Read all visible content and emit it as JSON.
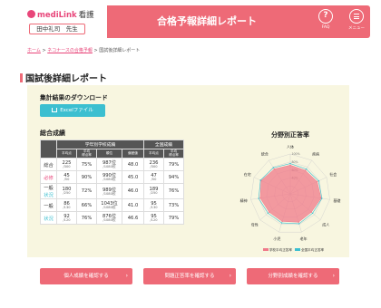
{
  "header": {
    "logo_brand": "mediLink",
    "logo_sub": "看護",
    "user_name": "田中礼司　先生",
    "title": "合格予報詳細レポート",
    "faq_label": "FAQ",
    "faq_icon": "question-circle-icon",
    "menu_label": "メニュー",
    "menu_icon": "hamburger-icon"
  },
  "breadcrumb": {
    "home": "ホーム",
    "sep1": " > ",
    "parent": "ネコナースの合格予報",
    "sep2": " > ",
    "current": "国試後詳細レポート"
  },
  "page_title": "国試後詳細レポート",
  "download": {
    "title": "集計結果のダウンロード",
    "excel_label": "Excelファイル",
    "excel_icon": "download-icon"
  },
  "summary": {
    "title": "総合成績",
    "group_school": "学年別学校成績",
    "group_national": "全国成績",
    "sub_headers": [
      "平均点",
      "平均\n得点率",
      "順位",
      "偏差値",
      "平均点",
      "平均\n得点率"
    ],
    "rows": [
      {
        "label": "総合",
        "label_color": "",
        "avg": "225",
        "avg_of": "/300",
        "rate": "75%",
        "rank": "987位",
        "rank_of": "/1080校",
        "dev": "48.0",
        "nat_avg": "236",
        "nat_of": "/300",
        "nat_rate": "79%"
      },
      {
        "label": "必修",
        "label_color": "pink",
        "avg": "45",
        "avg_of": "/50",
        "rate": "90%",
        "rank": "990位",
        "rank_of": "/1080校",
        "dev": "45.0",
        "nat_avg": "47",
        "nat_of": "/50",
        "nat_rate": "94%"
      },
      {
        "label": "一般状況",
        "label_color": "mixed",
        "avg": "180",
        "avg_of": "/250",
        "rate": "72%",
        "rank": "989位",
        "rank_of": "/1080校",
        "dev": "46.0",
        "nat_avg": "189",
        "nat_of": "/250",
        "nat_rate": "76%"
      },
      {
        "label": "一般",
        "label_color": "",
        "avg": "86",
        "avg_of": "/130",
        "rate": "66%",
        "rank": "1043位",
        "rank_of": "/1080校",
        "dev": "41.0",
        "nat_avg": "95",
        "nat_of": "/130",
        "nat_rate": "73%"
      },
      {
        "label": "状況",
        "label_color": "blue",
        "avg": "92",
        "avg_of": "/120",
        "rate": "76%",
        "rank": "876位",
        "rank_of": "/1080校",
        "dev": "46.6",
        "nat_avg": "95",
        "nat_of": "/120",
        "nat_rate": "79%"
      }
    ]
  },
  "chart_data": {
    "type": "radar",
    "title": "分野別正答率",
    "categories": [
      "人体",
      "疾病",
      "社会",
      "基礎",
      "成人",
      "老年",
      "小児",
      "母性",
      "精神",
      "在宅",
      "統合"
    ],
    "ticks": [
      "100%",
      "80%",
      "60%",
      "40%"
    ],
    "rlim": [
      0,
      100
    ],
    "series": [
      {
        "name": "学校平均正答率",
        "color": "#f07a8a",
        "values": [
          72,
          70,
          74,
          78,
          70,
          74,
          72,
          70,
          76,
          80,
          74
        ]
      },
      {
        "name": "全国平均正答率",
        "color": "#3cbfd0",
        "values": [
          76,
          74,
          78,
          80,
          74,
          78,
          76,
          74,
          80,
          82,
          78
        ]
      }
    ]
  },
  "buttons": {
    "b1": "個人成績を確認する",
    "b2": "問題正答率を確認する",
    "b3": "分野別成績を確認する",
    "arrow": "›"
  }
}
